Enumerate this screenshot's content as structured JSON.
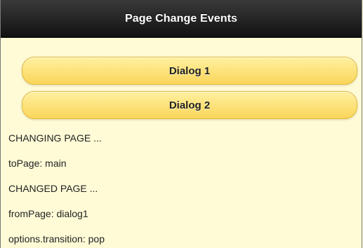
{
  "header": {
    "title": "Page Change Events"
  },
  "buttons": [
    {
      "label": "Dialog 1"
    },
    {
      "label": "Dialog 2"
    }
  ],
  "log": [
    "CHANGING PAGE ...",
    "toPage: main",
    "CHANGED PAGE ...",
    "fromPage: dialog1",
    "options.transition: pop"
  ],
  "colors": {
    "page_background": "#fffbd6",
    "header_background": "#1a1a1a",
    "button_fill": "#fad65a",
    "button_border": "#e2b93a"
  }
}
